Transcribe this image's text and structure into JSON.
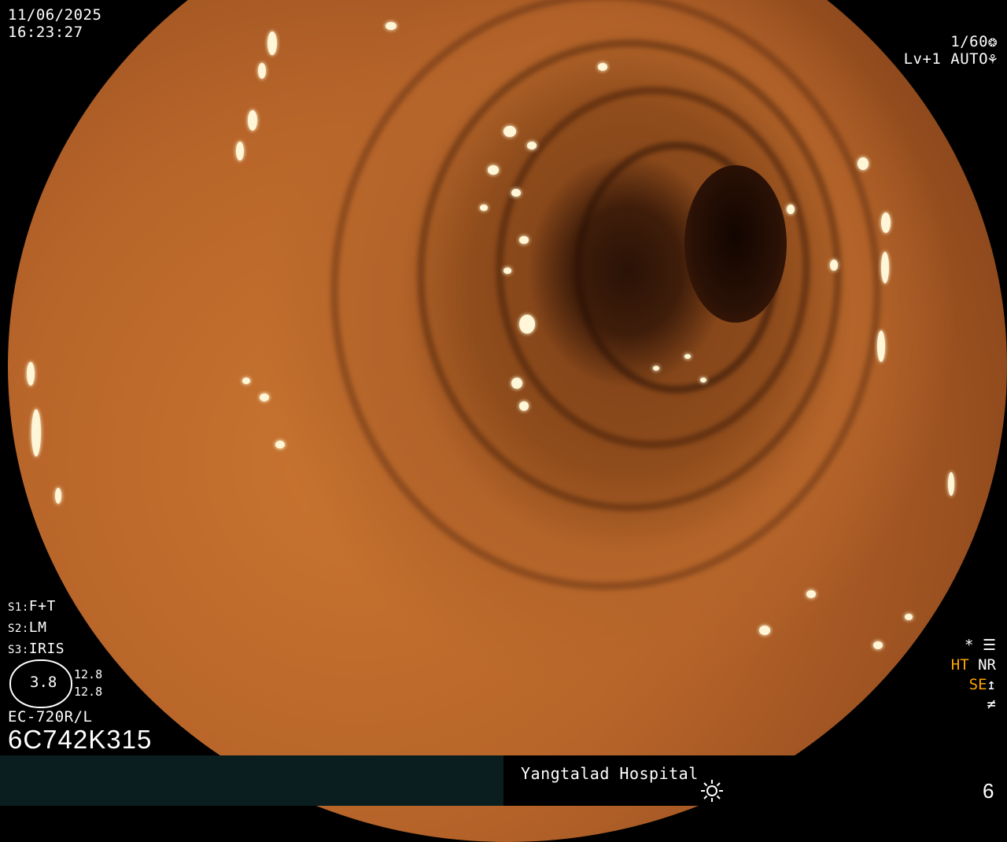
{
  "overlay": {
    "date": "11/06/2025",
    "time": "16:23:27",
    "shutter": "1/60",
    "level": "Lv+1",
    "auto": "AUTO",
    "settings": {
      "s1_key": "S1:",
      "s1_val": "F+T",
      "s2_key": "S2:",
      "s2_val": "LM",
      "s3_key": "S3:",
      "s3_val": "IRIS"
    },
    "gauge_value": "3.8",
    "gauge_num_top": "12.8",
    "gauge_num_bottom": "12.8",
    "scope_model": "EC-720R/L",
    "serial": "6C742K315",
    "star": "*",
    "ht": "HT",
    "nr": "NR",
    "se": "SE",
    "hospital": "Yangtalad Hospital",
    "page_number": "6"
  },
  "colors": {
    "accent_orange": "#ffa500",
    "bar_bg": "#0a1d1f",
    "tissue": "#b5652a"
  },
  "icons": [
    "shutter-icon",
    "auto-iris-icon",
    "settings-sliders-icon",
    "enhance-curve-icon",
    "disabled-icon",
    "brightness-sun-icon",
    "lens-gauge-icon"
  ]
}
